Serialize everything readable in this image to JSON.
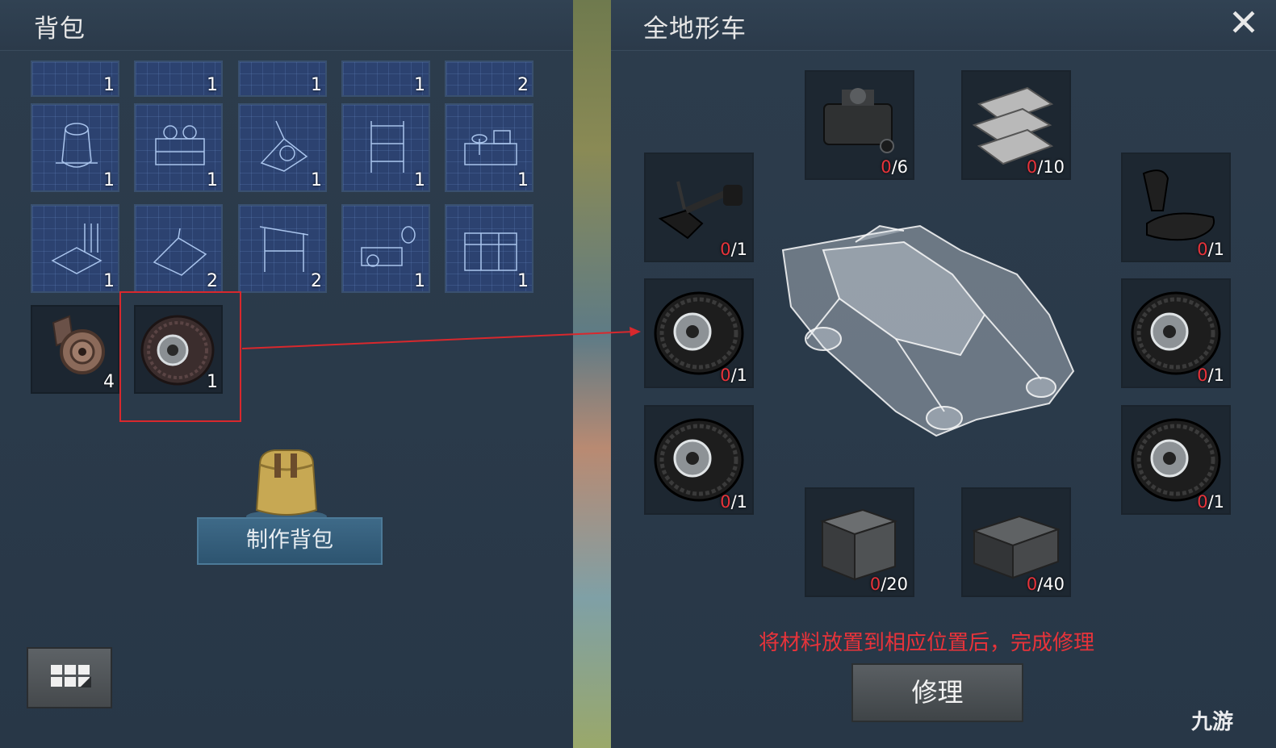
{
  "left_panel": {
    "title": "背包",
    "top_row_counts": [
      "1",
      "1",
      "1",
      "1",
      "2"
    ],
    "grid_rows": [
      [
        "1",
        "1",
        "1",
        "1",
        "1"
      ],
      [
        "1",
        "2",
        "2",
        "1",
        "1"
      ]
    ],
    "items": [
      {
        "name": "pulley",
        "count": "4"
      },
      {
        "name": "wheel",
        "count": "1"
      }
    ],
    "craft_button_label": "制作背包"
  },
  "right_panel": {
    "title": "全地形车",
    "materials": {
      "engine": {
        "have": "0",
        "need": "/6"
      },
      "wood": {
        "have": "0",
        "need": "/10"
      },
      "handlebar": {
        "have": "0",
        "need": "/1"
      },
      "seat": {
        "have": "0",
        "need": "/1"
      },
      "wheel_left_top": {
        "have": "0",
        "need": "/1"
      },
      "wheel_right_top": {
        "have": "0",
        "need": "/1"
      },
      "wheel_left_bottom": {
        "have": "0",
        "need": "/1"
      },
      "wheel_right_bottom": {
        "have": "0",
        "need": "/1"
      },
      "metal_box": {
        "have": "0",
        "need": "/20"
      },
      "crate": {
        "have": "0",
        "need": "/40"
      }
    },
    "hint": "将材料放置到相应位置后，完成修理",
    "repair_label": "修理",
    "close_icon": "close-icon"
  },
  "watermark": "九游",
  "colors": {
    "accent_red": "#e8333a",
    "panel_bg": "#2b3a49",
    "blueprint_bg": "#2c4270"
  }
}
